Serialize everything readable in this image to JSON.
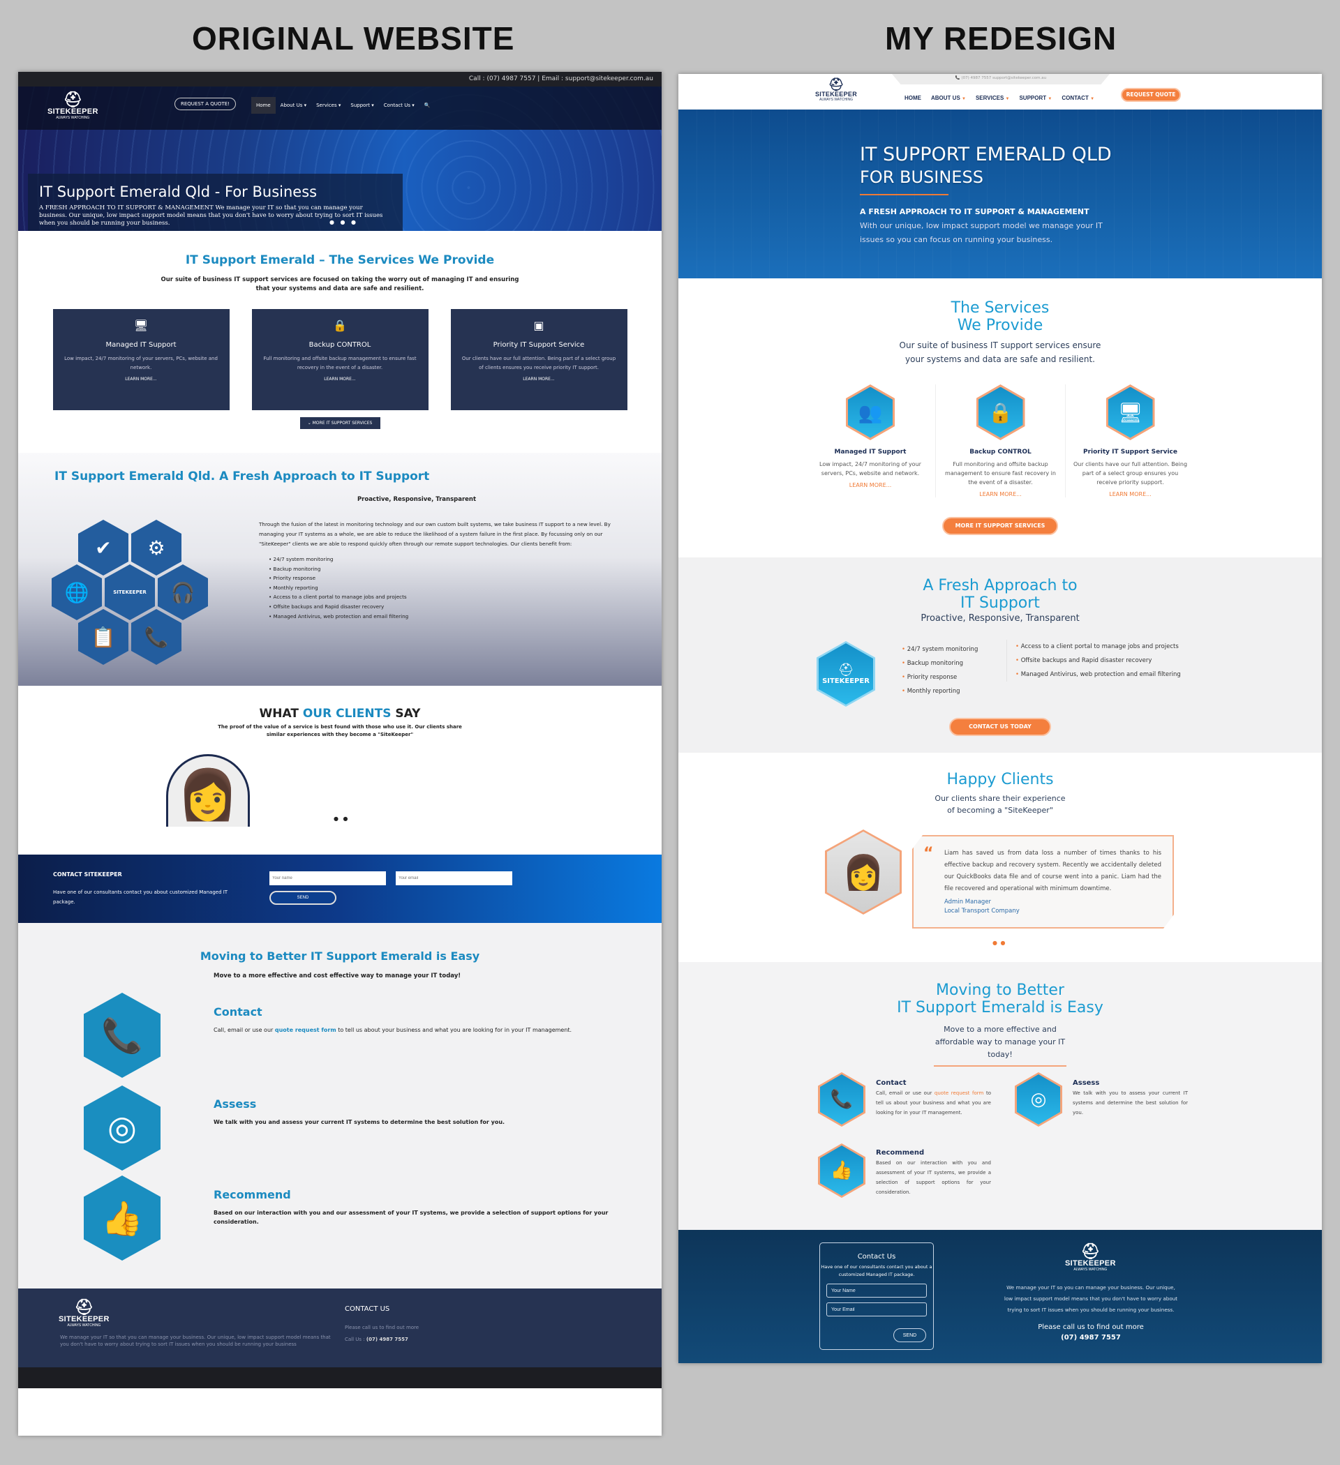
{
  "captions": {
    "left": "ORIGINAL WEBSITE",
    "right": "MY REDESIGN"
  },
  "original": {
    "topbar": "Call : (07) 4987 7557 | Email : support@sitekeeper.com.au",
    "logo": {
      "name": "SITEKEEPER",
      "tagline": "ALWAYS WATCHING"
    },
    "request_quote": "REQUEST A QUOTE!",
    "nav": [
      "Home",
      "About Us ▾",
      "Services ▾",
      "Support ▾",
      "Contact Us ▾"
    ],
    "search_icon": "🔍",
    "hero": {
      "title": "IT Support Emerald Qld - For Business",
      "text": "A FRESH APPROACH TO IT SUPPORT & MANAGEMENT We manage your IT so that you can manage your business. Our unique, low impact support model means that you don't have to worry about trying to sort IT issues when you should be running your business.",
      "dots": "● ● ●"
    },
    "services": {
      "title": "IT Support Emerald – The Services We Provide",
      "subtitle": "Our suite of business IT support services are focused on taking the worry out of managing IT and ensuring that your systems and data are safe and resilient.",
      "cards": [
        {
          "icon": "🖥",
          "title": "Managed IT Support",
          "text": "Low impact, 24/7 monitoring of your servers, PCs, website and network.",
          "link": "LEARN MORE..."
        },
        {
          "icon": "🔒",
          "title": "Backup CONTROL",
          "text": "Full monitoring and offsite backup management to ensure fast recovery in the event of a disaster.",
          "link": "LEARN MORE..."
        },
        {
          "icon": "▣",
          "title": "Priority IT Support Service",
          "text": "Our clients have our full attention. Being part of a select group of clients ensures you receive priority IT support.",
          "link": "LEARN MORE..."
        }
      ],
      "more_button": "⌄ MORE IT SUPPORT SERVICES"
    },
    "fresh": {
      "title": "IT Support Emerald Qld. A Fresh Approach to IT Support",
      "tagline": "Proactive, Responsive, Transparent",
      "text": "Through the fusion of the latest in monitoring technology and our own custom built systems, we take business IT support to a new level. By managing your IT systems as a whole, we are able to reduce the likelihood of a system failure in the first place. By focussing only on our \"SiteKeeper\" clients we are able to respond quickly often through our remote support technologies. Our clients benefit from:",
      "benefits": [
        "24/7 system monitoring",
        "Backup monitoring",
        "Priority response",
        "Monthly reporting",
        "Access to a client portal to manage jobs and projects",
        "Offsite backups and Rapid disaster recovery",
        "Managed Antivirus, web protection and email filtering"
      ],
      "hex_icons": [
        "✔",
        "⚙",
        "🌐",
        "SITEKEEPER",
        "🎧",
        "📋",
        "📞"
      ]
    },
    "clients": {
      "title_a": "WHAT ",
      "title_b": "OUR CLIENTS",
      "title_c": " SAY",
      "subtitle": "The proof of the value of a service is best found with those who use it. Our clients share similar experiences with they become a \"SiteKeeper\"",
      "dots": "● ●"
    },
    "contact": {
      "title": "CONTACT SITEKEEPER",
      "text": "Have one of our consultants contact you about customized Managed IT package.",
      "name_placeholder": "Your name",
      "email_placeholder": "Your email",
      "send": "SEND"
    },
    "easy": {
      "title": "Moving to Better IT Support Emerald is Easy",
      "lead": "Move to a more effective and cost effective way to manage your IT today!",
      "steps": [
        {
          "icon": "📞",
          "title": "Contact",
          "pre": "Call, email or use our ",
          "link": "quote request form",
          "post": " to tell us about your business and what you are looking for in your IT management."
        },
        {
          "icon": "◎",
          "title": "Assess",
          "text": "We talk with you and assess your current IT systems to determine the best solution for you."
        },
        {
          "icon": "👍",
          "title": "Recommend",
          "text": "Based on our interaction with you and our assessment of your IT systems, we provide a selection of support options for your consideration."
        }
      ]
    },
    "footer": {
      "text": "We manage your IT so that you can manage your business. Our unique, low impact support model means that you don't have to worry about trying to sort IT issues when you should be running your business",
      "contact_title": "CONTACT US",
      "call_prompt": "Please call us to find out more",
      "call_label": "Call Us : ",
      "phone": "(07) 4987 7557"
    }
  },
  "redesign": {
    "contactbar": "📞 (07) 4987 7557     support@sitekeeper.com.au",
    "logo": {
      "name": "SITEKEEPER",
      "tagline": "ALWAYS WATCHING"
    },
    "nav": [
      {
        "label": "HOME",
        "arrow": ""
      },
      {
        "label": "ABOUT US",
        "arrow": "▼"
      },
      {
        "label": "SERVICES",
        "arrow": "▼"
      },
      {
        "label": "SUPPORT",
        "arrow": "▼"
      },
      {
        "label": "CONTACT",
        "arrow": "▼"
      }
    ],
    "request_quote": "REQUEST QUOTE",
    "hero": {
      "title": "IT SUPPORT EMERALD QLD",
      "title2": "FOR BUSINESS",
      "kicker": "A FRESH APPROACH TO IT SUPPORT & MANAGEMENT",
      "text": "With our unique, low impact support model we manage your IT issues so you can focus on running your business."
    },
    "services": {
      "title1": "The Services",
      "title2": "We Provide",
      "subtitle": "Our suite of business IT support services ensure your systems and data are safe and resilient.",
      "cards": [
        {
          "icon": "👥",
          "title": "Managed IT  Support",
          "text": "Low impact, 24/7 monitoring of your servers, PCs, website and network.",
          "link": "LEARN MORE..."
        },
        {
          "icon": "🔒",
          "title": "Backup CONTROL",
          "text": "Full monitoring and offsite backup management to ensure fast recovery in the event of a disaster.",
          "link": "LEARN MORE..."
        },
        {
          "icon": "🖥",
          "title": "Priority IT Support Service",
          "text": "Our clients have our full attention. Being part of a select group ensures you receive priority support.",
          "link": "LEARN MORE..."
        }
      ],
      "more_button": "MORE IT SUPPORT SERVICES"
    },
    "fresh": {
      "title1": "A Fresh Approach to",
      "title2": "IT Support",
      "tagline": "Proactive, Responsive, Transparent",
      "list_a": [
        "24/7 system monitoring",
        "Backup monitoring",
        "Priority response",
        "Monthly reporting"
      ],
      "list_b": [
        "Access to a client portal to manage jobs and projects",
        "Offsite backups and Rapid disaster recovery",
        "Managed Antivirus, web protection and email filtering"
      ],
      "cta": "CONTACT US TODAY"
    },
    "clients": {
      "title": "Happy Clients",
      "subtitle": "Our clients share their experience of becoming a \"SiteKeeper\"",
      "quote": "Liam has saved us from data loss a number of times thanks to his effective backup and recovery system. Recently we accidentally deleted our QuickBooks data file and of course went into a panic. Liam had the file recovered and operational with minimum downtime.",
      "role": "Admin Manager",
      "company": "Local Transport Company",
      "dots": "● ●"
    },
    "easy": {
      "title1": "Moving to Better",
      "title2": "IT Support Emerald is Easy",
      "subtitle": "Move to a more effective and affordable way to manage your IT today!",
      "steps": [
        {
          "icon": "📞",
          "title": "Contact",
          "pre": "Call, email or use our ",
          "link": "quote request form",
          "post": " to tell us about your business and what you are looking for in your IT management."
        },
        {
          "icon": "◎",
          "title": "Assess",
          "text": "We talk with you to assess your current IT systems and determine the best solution for you."
        },
        {
          "icon": "👍",
          "title": "Recommend",
          "text": "Based on our interaction with you and assessment of your IT systems, we provide a selection of support options for your consideration."
        }
      ]
    },
    "footer": {
      "form_title": "Contact Us",
      "form_text": "Have one of our consultants contact you about a customized Managed IT package.",
      "name_placeholder": "Your Name",
      "email_placeholder": "Your Email",
      "send": "SEND",
      "text": "We manage your IT so you can manage your business. Our unique, low impact support model means that you don't have to worry about trying to sort IT issues when you should be running your business.",
      "call_prompt": "Please call us to find out more",
      "phone": "(07) 4987 7557"
    }
  }
}
